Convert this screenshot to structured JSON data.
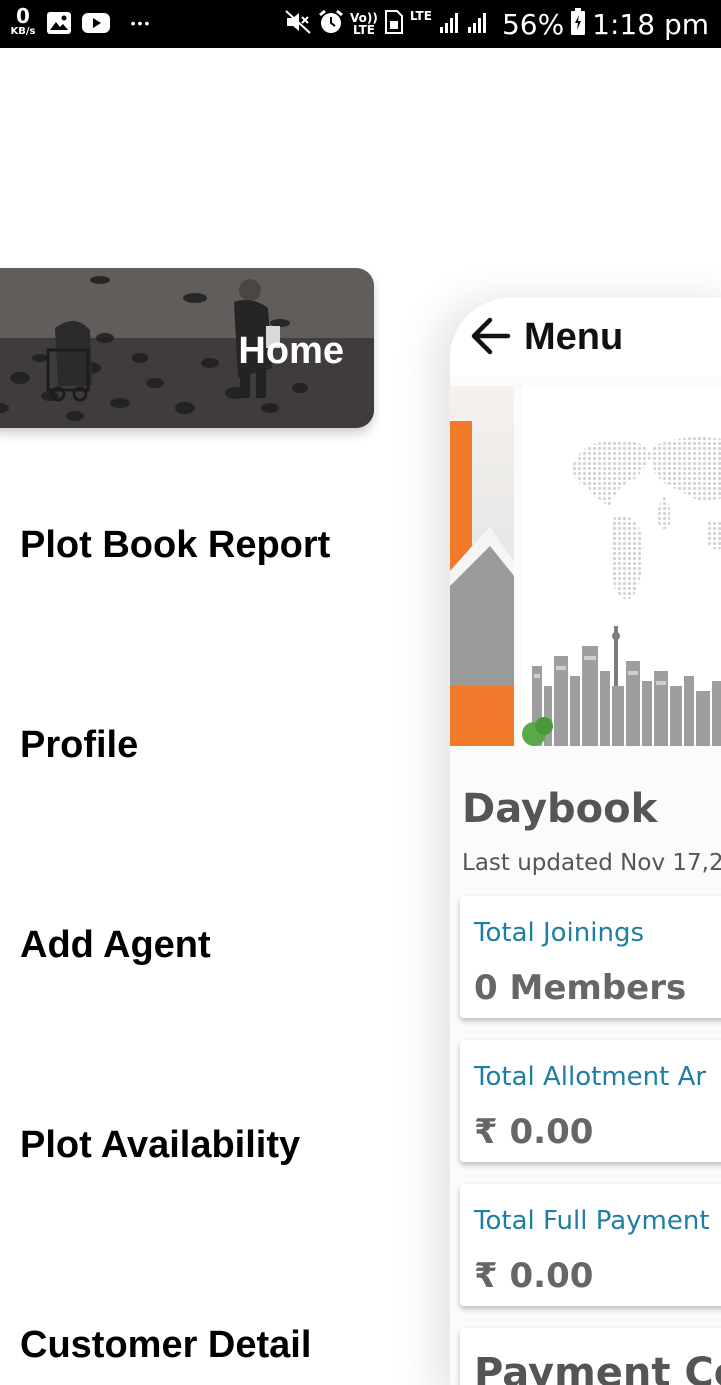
{
  "status_bar": {
    "net_speed_value": "0",
    "net_speed_unit": "KB/s",
    "volte_top": "Vo))",
    "volte_bottom": "LTE",
    "lte_label": "LTE",
    "battery": "56%",
    "time": "1:18 pm",
    "more": "•••",
    "icons": [
      "gallery-icon",
      "youtube-icon",
      "mute-icon",
      "alarm-icon",
      "sim-icon",
      "signal-icon",
      "battery-icon"
    ]
  },
  "drawer": {
    "home_label": "Home",
    "items": [
      {
        "label": "Plot Book Report"
      },
      {
        "label": "Profile"
      },
      {
        "label": "Add Agent"
      },
      {
        "label": "Plot Availability"
      },
      {
        "label": "Customer Detail"
      }
    ]
  },
  "main": {
    "header_title": "Menu",
    "daybook": {
      "title": "Daybook",
      "last_updated": "Last updated Nov 17,2"
    },
    "cards": [
      {
        "label": "Total Joinings",
        "value": "0 Members"
      },
      {
        "label": "Total Allotment Ar",
        "value": "₹ 0.00"
      },
      {
        "label": "Total Full Payment",
        "value": "₹ 0.00"
      },
      {
        "label": "Payment Co",
        "value": ""
      }
    ]
  },
  "colors": {
    "accent_blue": "#1f7ea1",
    "value_gray": "#666666",
    "orange_banner": "#f07a2a"
  }
}
